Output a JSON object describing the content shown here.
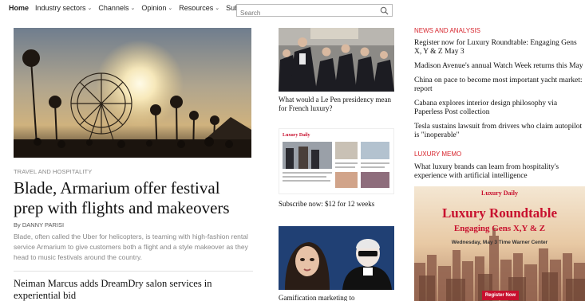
{
  "nav": {
    "items": [
      {
        "label": "Home",
        "dropdown": false
      },
      {
        "label": "Industry sectors",
        "dropdown": true
      },
      {
        "label": "Channels",
        "dropdown": true
      },
      {
        "label": "Opinion",
        "dropdown": true
      },
      {
        "label": "Resources",
        "dropdown": true
      },
      {
        "label": "Subscribe",
        "dropdown": false
      }
    ],
    "search_placeholder": "Search"
  },
  "feature": {
    "kicker": "TRAVEL AND HOSPITALITY",
    "headline": "Blade, Armarium offer festival prep with flights and makeovers",
    "byline": "By DANNY PARISI",
    "dek": "Blade, often called the Uber for helicopters, is teaming with high-fashion rental service Armarium to give customers both a flight and a style makeover as they head to music festivals around the country.",
    "second_headline": "Neiman Marcus adds DreamDry salon services in experiential bid"
  },
  "middle": {
    "story1": "What would a Le Pen presidency mean for French luxury?",
    "story2_brand": "Luxury Daily",
    "story2": "Subscribe now: $12 for 12 weeks",
    "story3": "Gamification marketing to"
  },
  "right": {
    "news_label": "NEWS AND ANALYSIS",
    "news": [
      "Register now for Luxury Roundtable: Engaging Gens X, Y & Z May 3",
      "Madison Avenue's annual Watch Week returns this May",
      "China on pace to become most important yacht market: report",
      "Cabana explores interior design philosophy via Paperless Post collection",
      "Tesla sustains lawsuit from drivers who claim autopilot is \"inoperable\""
    ],
    "memo_label": "LUXURY MEMO",
    "memo_item": "What luxury brands can learn from hospitality's experience with artificial intelligence"
  },
  "ad": {
    "brand": "Luxury Daily",
    "title": "Luxury Roundtable",
    "subtitle": "Engaging Gens X,Y & Z",
    "date": "Wednesday, May 3    Time Warner Center",
    "button": "Register Now"
  },
  "colors": {
    "accent": "#d7262e",
    "ad_red": "#c8102e"
  }
}
